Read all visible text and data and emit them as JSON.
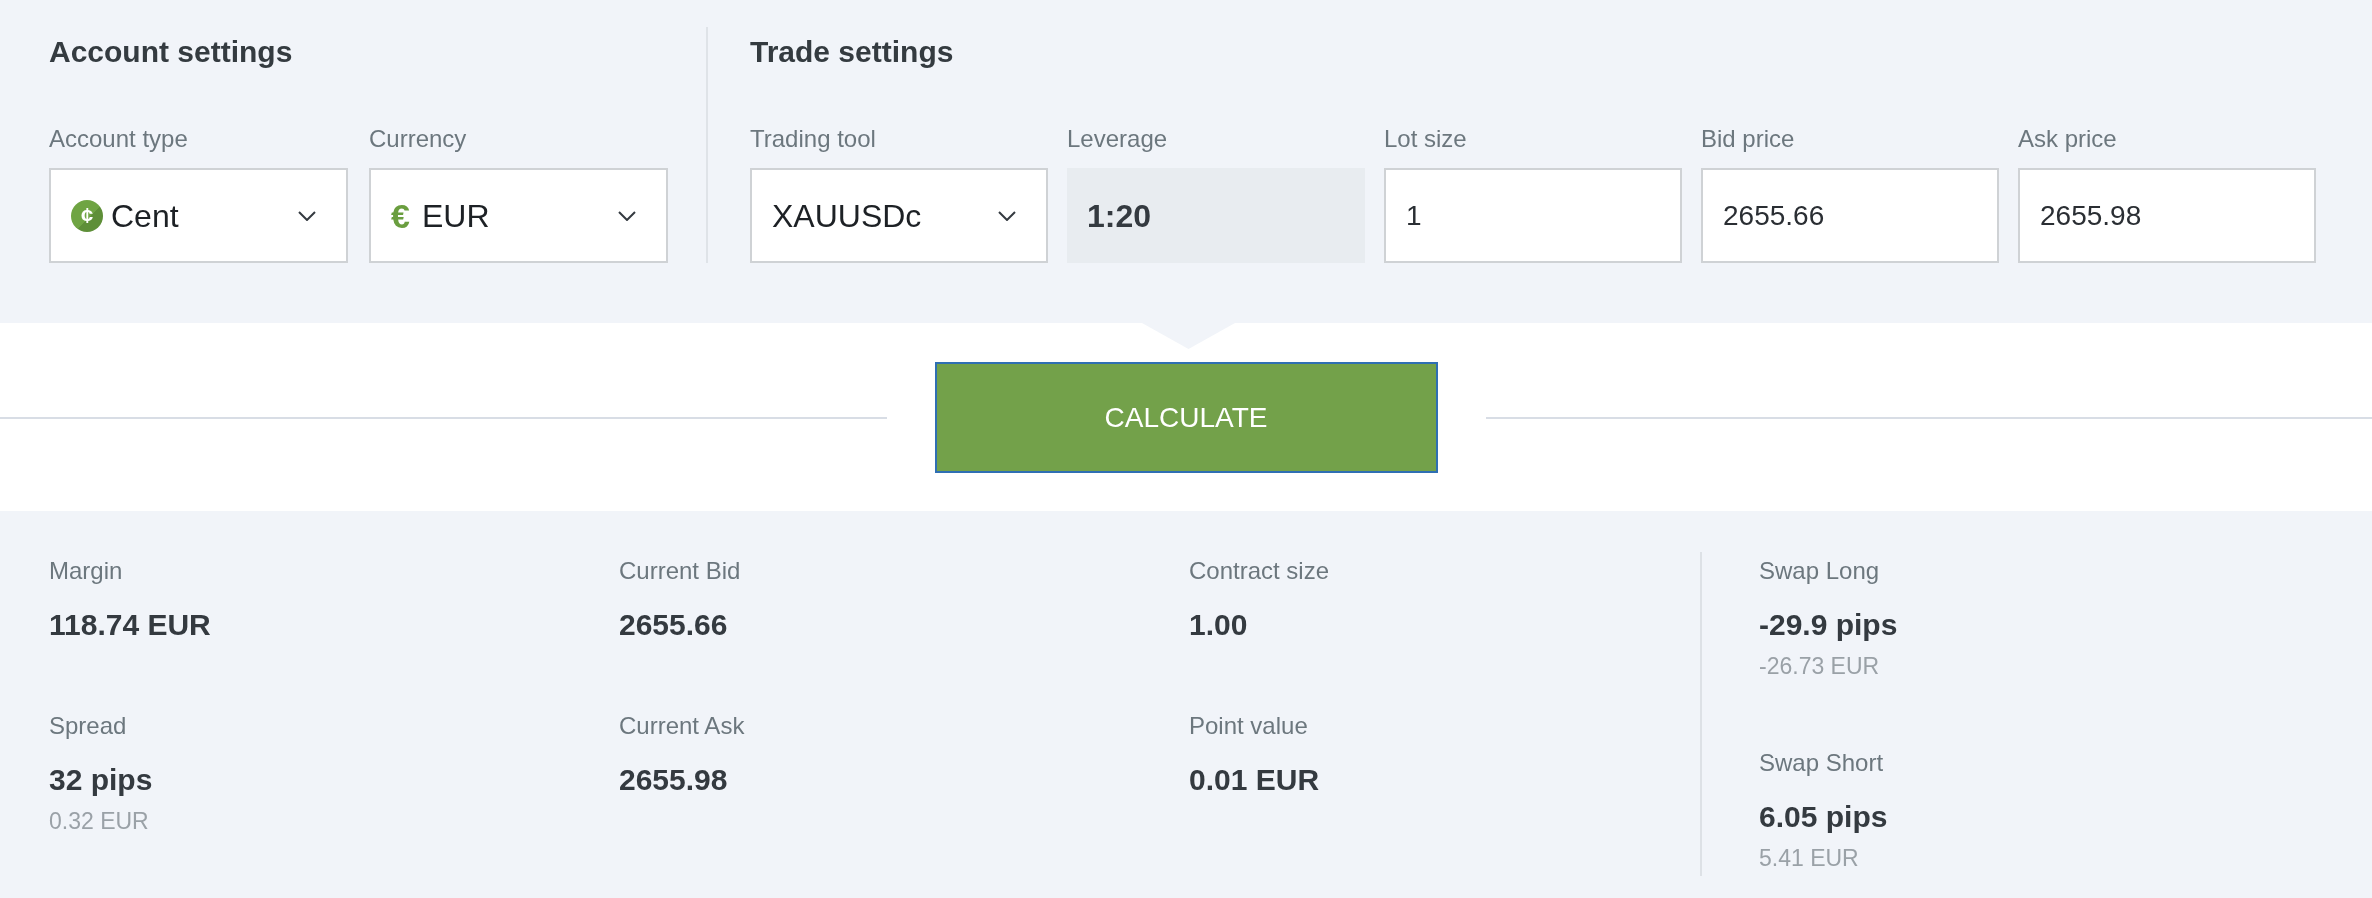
{
  "account_settings": {
    "title": "Account settings",
    "fields": [
      {
        "kind": "select",
        "label": "Account type",
        "symbol": {
          "kind": "coin",
          "text": "¢"
        },
        "value": "Cent"
      },
      {
        "kind": "select",
        "label": "Currency",
        "symbol": {
          "kind": "plain",
          "text": "€"
        },
        "value": "EUR"
      }
    ]
  },
  "trade_settings": {
    "title": "Trade settings",
    "fields": [
      {
        "kind": "select",
        "label": "Trading tool",
        "value": "XAUUSDc"
      },
      {
        "kind": "readonly",
        "label": "Leverage",
        "value": "1:20"
      },
      {
        "kind": "input",
        "label": "Lot size",
        "value": "1"
      },
      {
        "kind": "input",
        "label": "Bid price",
        "value": "2655.66"
      },
      {
        "kind": "input",
        "label": "Ask price",
        "value": "2655.98"
      }
    ]
  },
  "calculate_button": {
    "label": "CALCULATE",
    "focused": true
  },
  "results": {
    "columns": [
      {
        "items": [
          {
            "label": "Margin",
            "value": "118.74 EUR"
          },
          {
            "label": "Spread",
            "value": "32 pips",
            "sub": "0.32 EUR"
          }
        ]
      },
      {
        "items": [
          {
            "label": "Current Bid",
            "value": "2655.66"
          },
          {
            "label": "Current Ask",
            "value": "2655.98"
          }
        ]
      },
      {
        "items": [
          {
            "label": "Contract size",
            "value": "1.00"
          },
          {
            "label": "Point value",
            "value": "0.01 EUR"
          }
        ]
      }
    ],
    "swap": {
      "items": [
        {
          "label": "Swap Long",
          "value": "-29.9 pips",
          "sub": "-26.73 EUR"
        },
        {
          "label": "Swap Short",
          "value": "6.05 pips",
          "sub": "5.41 EUR"
        }
      ]
    }
  }
}
